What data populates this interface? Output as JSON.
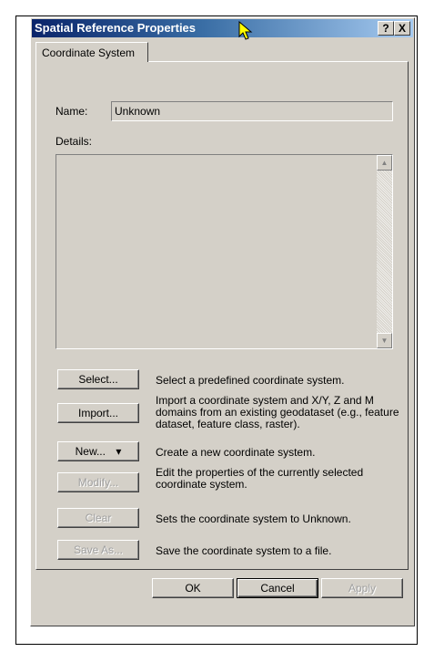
{
  "dialog": {
    "title": "Spatial Reference Properties",
    "help_label": "?",
    "close_label": "X"
  },
  "tabs": [
    {
      "label": "Coordinate System"
    }
  ],
  "fields": {
    "name_label": "Name:",
    "name_value": "Unknown",
    "details_label": "Details:",
    "details_value": ""
  },
  "actions": [
    {
      "label": "Select...",
      "description": "Select a predefined coordinate system.",
      "enabled": true
    },
    {
      "label": "Import...",
      "description": "Import a coordinate system and X/Y, Z and M domains from an existing geodataset (e.g., feature dataset, feature class, raster).",
      "enabled": true
    },
    {
      "label": "New...",
      "arrow": "▾",
      "description": "Create a new coordinate system.",
      "enabled": true
    },
    {
      "label": "Modify...",
      "description": "Edit the properties of the currently selected coordinate system.",
      "enabled": false
    },
    {
      "label": "Clear",
      "description": "Sets the coordinate system to Unknown.",
      "enabled": false
    },
    {
      "label": "Save As...",
      "description": "Save the coordinate system to a file.",
      "enabled": false
    }
  ],
  "footer": {
    "ok_label": "OK",
    "cancel_label": "Cancel",
    "apply_label": "Apply"
  },
  "icons": {
    "scroll_up": "▲",
    "scroll_down": "▼"
  }
}
